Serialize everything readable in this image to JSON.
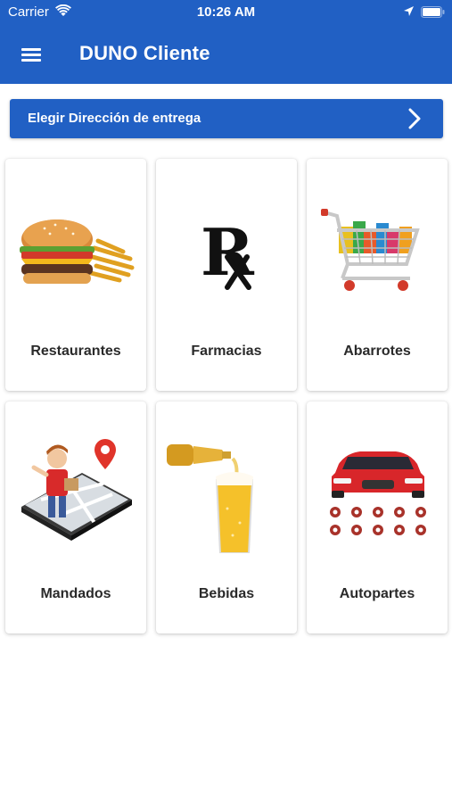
{
  "status_bar": {
    "carrier": "Carrier",
    "time": "10:26 AM"
  },
  "header": {
    "title": "DUNO Cliente",
    "color": "#2160c4"
  },
  "address": {
    "label": "Elegir Dirección de entrega"
  },
  "categories": [
    {
      "label": "Restaurantes",
      "icon": "burger-fries-image"
    },
    {
      "label": "Farmacias",
      "icon": "rx-symbol-image"
    },
    {
      "label": "Abarrotes",
      "icon": "shopping-cart-image"
    },
    {
      "label": "Mandados",
      "icon": "delivery-map-image"
    },
    {
      "label": "Bebidas",
      "icon": "beer-pour-image"
    },
    {
      "label": "Autopartes",
      "icon": "car-parts-image"
    }
  ]
}
